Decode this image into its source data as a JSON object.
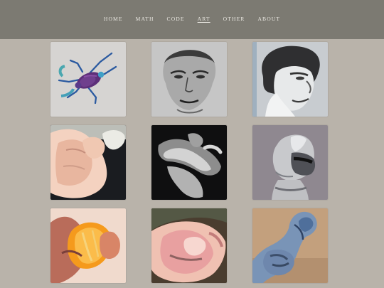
{
  "nav": {
    "items": [
      {
        "label": "HOME",
        "active": false
      },
      {
        "label": "MATH",
        "active": false
      },
      {
        "label": "CODE",
        "active": false
      },
      {
        "label": "ART",
        "active": true
      },
      {
        "label": "OTHER",
        "active": false
      },
      {
        "label": "ABOUT",
        "active": false
      }
    ]
  },
  "gallery": {
    "tiles": [
      {
        "subject": "beetle-illustration"
      },
      {
        "subject": "sketched-portrait"
      },
      {
        "subject": "portrait-in-profile"
      },
      {
        "subject": "hands-painting"
      },
      {
        "subject": "hands-black-and-white"
      },
      {
        "subject": "armor-helmet"
      },
      {
        "subject": "orange-held-in-hand"
      },
      {
        "subject": "face-closeup"
      },
      {
        "subject": "blue-figure"
      }
    ]
  }
}
